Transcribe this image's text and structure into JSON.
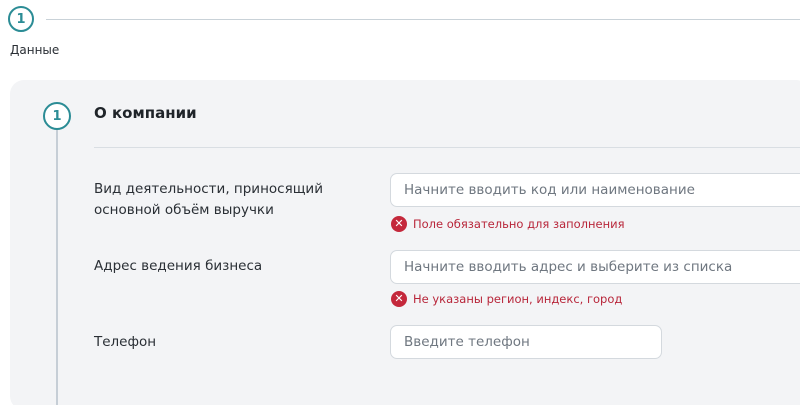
{
  "stepper": {
    "step_number": "1",
    "step_label": "Данные"
  },
  "section": {
    "number": "1",
    "title": "О компании"
  },
  "fields": {
    "activity": {
      "label_line1": "Вид деятельности, приносящий",
      "label_line2": "основной объём выручки",
      "placeholder": "Начните вводить код или наименование",
      "value": "",
      "error": "Поле обязательно для заполнения"
    },
    "address": {
      "label": "Адрес ведения бизнеса",
      "placeholder": "Начните вводить адрес и выберите из списка",
      "value": "",
      "error": "Не указаны регион, индекс, город"
    },
    "phone": {
      "label": "Телефон",
      "placeholder": "Введите телефон",
      "value": ""
    }
  },
  "colors": {
    "accent": "#2b8c95",
    "error": "#c4283b",
    "panel_bg": "#f3f4f6"
  },
  "icons": {
    "error": "x-circle-icon"
  }
}
